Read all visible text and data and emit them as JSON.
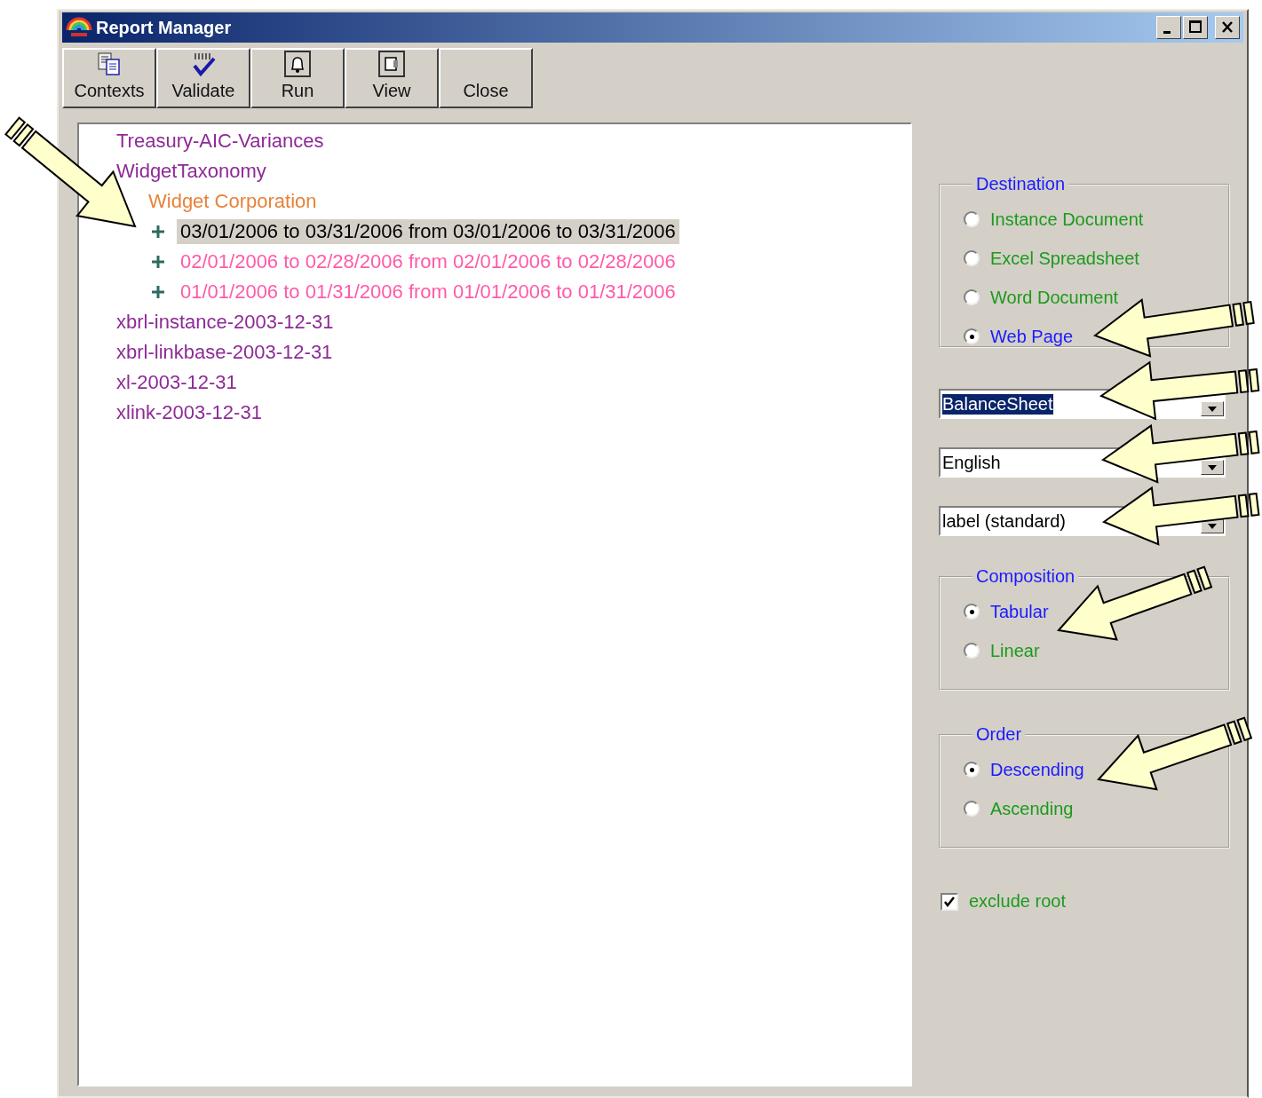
{
  "window": {
    "title": "Report Manager"
  },
  "toolbar": [
    {
      "label": "Contexts",
      "kind": "contexts"
    },
    {
      "label": "Validate",
      "kind": "validate"
    },
    {
      "label": "Run",
      "kind": "run"
    },
    {
      "label": "View",
      "kind": "view"
    },
    {
      "label": "Close",
      "kind": "plain"
    }
  ],
  "tree": [
    {
      "label": "Treasury-AIC-Variances",
      "selected": false
    },
    {
      "label": "WidgetTaxonomy",
      "selected": false,
      "children": [
        {
          "label": "Widget Corporation",
          "selected": false,
          "children": [
            {
              "label": "03/01/2006 to 03/31/2006 from 03/01/2006 to 03/31/2006",
              "selected": true,
              "expanded": false
            },
            {
              "label": "02/01/2006 to 02/28/2006 from 02/01/2006 to 02/28/2006",
              "selected": false,
              "expanded": false
            },
            {
              "label": "01/01/2006 to 01/31/2006 from 01/01/2006 to 01/31/2006",
              "selected": false,
              "expanded": false
            }
          ]
        }
      ]
    },
    {
      "label": "xbrl-instance-2003-12-31",
      "selected": false
    },
    {
      "label": "xbrl-linkbase-2003-12-31",
      "selected": false
    },
    {
      "label": "xl-2003-12-31",
      "selected": false
    },
    {
      "label": "xlink-2003-12-31",
      "selected": false
    }
  ],
  "destination": {
    "legend": "Destination",
    "options": [
      {
        "label": "Instance Document",
        "selected": false
      },
      {
        "label": "Excel Spreadsheet",
        "selected": false
      },
      {
        "label": "Word Document",
        "selected": false
      },
      {
        "label": "Web Page",
        "selected": true
      }
    ]
  },
  "combos": [
    {
      "value": "BalanceSheet",
      "focused": true
    },
    {
      "value": "English",
      "focused": false
    },
    {
      "value": "label (standard)",
      "focused": false
    }
  ],
  "composition": {
    "legend": "Composition",
    "options": [
      {
        "label": "Tabular",
        "selected": true
      },
      {
        "label": "Linear",
        "selected": false
      }
    ]
  },
  "order": {
    "legend": "Order",
    "options": [
      {
        "label": "Descending",
        "selected": true
      },
      {
        "label": "Ascending",
        "selected": false
      }
    ]
  },
  "exclude_root": {
    "label": "exclude root",
    "checked": true
  }
}
